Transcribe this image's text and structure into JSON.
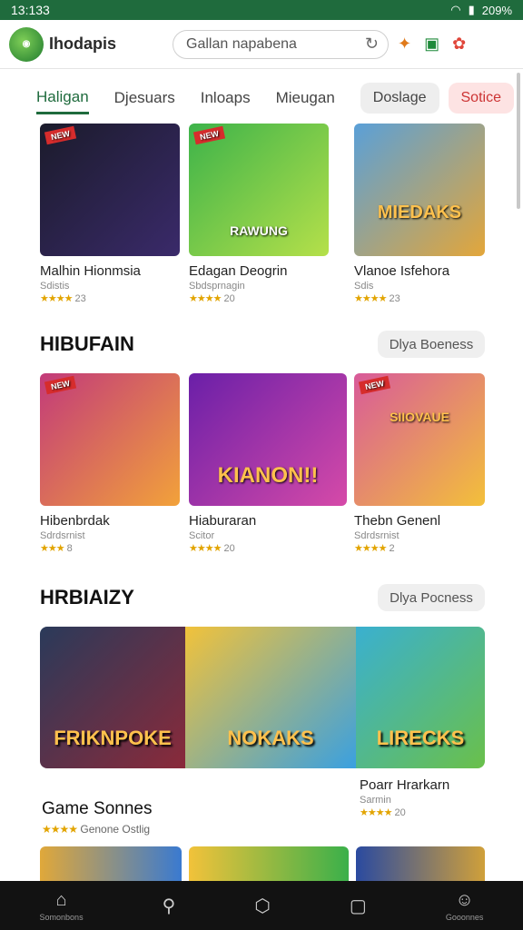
{
  "status": {
    "time": "13:133",
    "battery": "209%"
  },
  "header": {
    "app_name": "Ihodapis",
    "search_placeholder": "Gallan napabena"
  },
  "tabs": [
    {
      "label": "Haligan",
      "active": true,
      "style": "plain"
    },
    {
      "label": "Djesuars",
      "style": "plain"
    },
    {
      "label": "Inloaps",
      "style": "plain"
    },
    {
      "label": "Mieugan",
      "style": "plain"
    },
    {
      "label": "Doslage",
      "style": "pill"
    },
    {
      "label": "Sotice",
      "style": "pill-red"
    }
  ],
  "row1": [
    {
      "title": "Malhin Hionmsia",
      "sub": "Sdistis",
      "stars": "★★★★",
      "count": "23",
      "thumb_text": "",
      "colors": [
        "#1b1b2b",
        "#3a2a6a"
      ]
    },
    {
      "title": "Edagan Deogrin",
      "sub": "Sbdsprnagin",
      "stars": "★★★★",
      "count": "20",
      "thumb_text": "RAWUNG",
      "colors": [
        "#3db34a",
        "#b5e04a"
      ]
    },
    {
      "title": "Vlanoe Isfehora",
      "sub": "Sdis",
      "stars": "★★★★",
      "count": "23",
      "thumb_text": "MIEDAKS",
      "colors": [
        "#5aa0d8",
        "#e3a63a"
      ]
    }
  ],
  "section2": {
    "title": "HIBUFAIN",
    "button": "Dlya Boeness"
  },
  "row2": [
    {
      "title": "Hibenbrdak",
      "sub": "Sdrdsrnist",
      "stars": "★★★",
      "count": "8",
      "thumb_text": "",
      "colors": [
        "#c23a7a",
        "#f2a23a"
      ]
    },
    {
      "title": "Hiaburaran",
      "sub": "Scitor",
      "stars": "★★★★",
      "count": "20",
      "thumb_text": "KIANON!!",
      "colors": [
        "#6a1fa8",
        "#d64aa8"
      ]
    },
    {
      "title": "Thebn Genenl",
      "sub": "Sdrdsrnist",
      "stars": "★★★★",
      "count": "2",
      "thumb_text": "SIIOVAUE",
      "colors": [
        "#d85a9a",
        "#f3c03a"
      ]
    }
  ],
  "section3": {
    "title": "HRBIAIZY",
    "button": "Dlya Pocness"
  },
  "banner": [
    {
      "text": "FRIKNPOKE",
      "colors": [
        "#2a3a5a",
        "#8a2a3a"
      ]
    },
    {
      "text": "NOKAKS",
      "colors": [
        "#f2c23a",
        "#3aa0e0"
      ]
    },
    {
      "text": "LIRECKS",
      "colors": [
        "#3ab0d0",
        "#6ac04a"
      ]
    }
  ],
  "banner_right": {
    "title": "Poarr Hrarkarn",
    "sub": "Sarmin",
    "stars": "★★★★",
    "count": "20"
  },
  "game_sonnes": {
    "title": "Game Sonnes",
    "stars": "★★★★",
    "text": "Genone Ostlig"
  },
  "nav": [
    {
      "icon": "home-icon",
      "glyph": "⌂",
      "label": "Somonbons"
    },
    {
      "icon": "search-icon",
      "glyph": "⚲",
      "label": ""
    },
    {
      "icon": "hexagon-icon",
      "glyph": "⬡",
      "label": ""
    },
    {
      "icon": "square-icon",
      "glyph": "▢",
      "label": ""
    },
    {
      "icon": "controller-icon",
      "glyph": "☺",
      "label": "Gooonnes"
    }
  ]
}
